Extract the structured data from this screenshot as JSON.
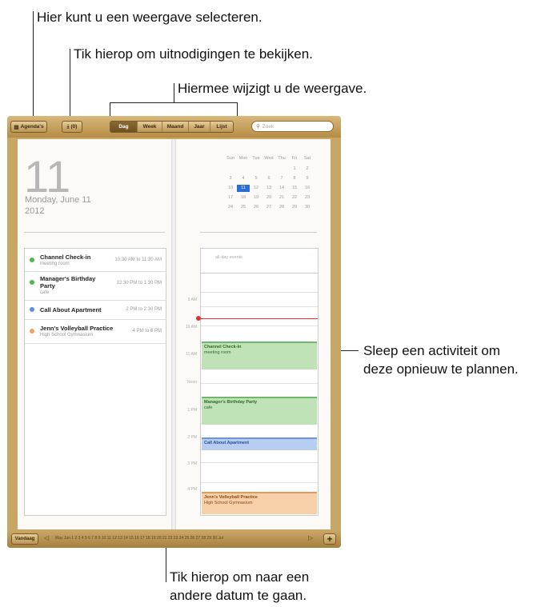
{
  "callouts": {
    "select_view": "Hier kunt u een weergave selecteren.",
    "invitations": "Tik hierop om uitnodigingen te bekijken.",
    "change_view": "Hiermee wijzigt u de weergave.",
    "drag_event_1": "Sleep een activiteit om",
    "drag_event_2": "deze opnieuw te plannen.",
    "other_date_1": "Tik hierop om naar een",
    "other_date_2": "andere datum te gaan."
  },
  "toolbar": {
    "calendars_label": "Agenda's",
    "invites_label": "(0)",
    "views": [
      "Dag",
      "Week",
      "Maand",
      "Jaar",
      "Lijst"
    ],
    "selected_view": "Dag",
    "search_placeholder": "Zoek"
  },
  "day": {
    "number": "11",
    "weekday_date": "Monday, June 11",
    "year": "2012"
  },
  "events": [
    {
      "title": "Channel Check-in",
      "subtitle": "meeting room",
      "time": "10:30 AM to 11:30 AM",
      "color": "#4cb84a"
    },
    {
      "title": "Manager's Birthday Party",
      "subtitle": "cafe",
      "time": "12:30 PM to 1:30 PM",
      "color": "#4cb84a"
    },
    {
      "title": "Call About Apartment",
      "subtitle": "",
      "time": "2 PM to 2:30 PM",
      "color": "#5b8fe0"
    },
    {
      "title": "Jenn's Volleyball Practice",
      "subtitle": "High School Gymnasium",
      "time": "4 PM to 6 PM",
      "color": "#f0a060"
    }
  ],
  "mini_calendar": {
    "weekdays": [
      "Sun",
      "Mon",
      "Tue",
      "Wed",
      "Thu",
      "Fri",
      "Sat"
    ],
    "weeks": [
      [
        "",
        "",
        "",
        "",
        "",
        "1",
        "2"
      ],
      [
        "3",
        "4",
        "5",
        "6",
        "7",
        "8",
        "9"
      ],
      [
        "10",
        "11",
        "12",
        "13",
        "14",
        "15",
        "16"
      ],
      [
        "17",
        "18",
        "19",
        "20",
        "21",
        "22",
        "23"
      ],
      [
        "24",
        "25",
        "26",
        "27",
        "28",
        "29",
        "30"
      ]
    ],
    "today": "11"
  },
  "day_view": {
    "all_day_label": "all-day events",
    "hours": [
      "9 AM",
      "10 AM",
      "11 AM",
      "Noon",
      "1 PM",
      "2 PM",
      "3 PM",
      "4 PM"
    ],
    "blocks": [
      {
        "title": "Channel Check-in",
        "subtitle": "meeting room",
        "bg": "#bfe3b6",
        "border": "#6fb86a",
        "fg": "#2d6a2a"
      },
      {
        "title": "Manager's Birthday Party",
        "subtitle": "cafe",
        "bg": "#bfe3b6",
        "border": "#6fb86a",
        "fg": "#2d6a2a"
      },
      {
        "title": "Call About Apartment",
        "subtitle": "",
        "bg": "#b7cdf2",
        "border": "#6e95da",
        "fg": "#2a4f95"
      },
      {
        "title": "Jenn's Volleyball Practice",
        "subtitle": "High School Gymnasium",
        "bg": "#f7cfa8",
        "border": "#e59a5a",
        "fg": "#8a4a16"
      }
    ]
  },
  "bottom": {
    "today_label": "Vandaag",
    "date_strip": "May  Jun 1 2 3 4 5 6 7 8 9 10 11 12 13 14 15 16 17 18 19 20 21 22 23 24 25 26 27 28 29 30  Jul",
    "add_label": "+"
  }
}
